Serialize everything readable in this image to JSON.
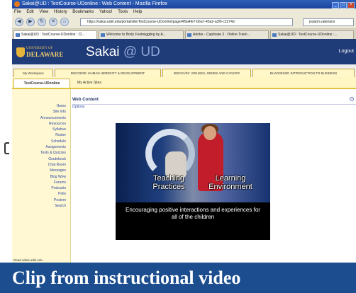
{
  "browser": {
    "window_title": "Sakai@UD : TestCourse-UDonline : Web Content - Mozilla Firefox",
    "menu": [
      "File",
      "Edit",
      "View",
      "History",
      "Bookmarks",
      "Yahoo!",
      "Tools",
      "Help"
    ],
    "url": "https://sakai.udel.edu/portal/site/TestCourse-UDonline/page/4f9a4fe7-b6a7-45a2-a3f0-c2274d",
    "search_value": "joseph.valeriano",
    "tabs": [
      {
        "label": "Sakai@UD : TestCourse-UDonline : Cl..."
      },
      {
        "label": "Welcome to Body Footwiggling by A..."
      },
      {
        "label": "Adobe - Captivate 3 : Online Traini..."
      },
      {
        "label": "Sakai@UD : TestCourse-UDonline :..."
      }
    ]
  },
  "header": {
    "logo_top": "UNIVERSITY OF",
    "logo_main": "DELAWARE",
    "brand": "Sakai",
    "brand_suffix": "@ UD",
    "logout": "Logout"
  },
  "worksites": [
    "My Workspace",
    "BISC05/06: HUMAN HEREDITY & DEVELOPMENT",
    "BISC01/02: VIRUSES, GENES AND CANCER",
    "BUAD301/08: INTRODUCTION TO BUSINESS"
  ],
  "subsites": [
    "TestCourse-UDonline",
    "My Active Sites"
  ],
  "sidebar": {
    "items": [
      "Home",
      "Site Info",
      "Announcements",
      "Resources",
      "Syllabus",
      "Roster",
      "Schedule",
      "Assignments",
      "Tests & Quizzes",
      "Gradebook",
      "Chat Room",
      "Messages",
      "Blog Wow",
      "Forums",
      "Podcasts",
      "Polls",
      "Postem",
      "Search"
    ],
    "status": "Read sakai.udel.edu"
  },
  "content": {
    "title": "Web Content",
    "options": "Options"
  },
  "video": {
    "label_left": "Teaching\nPractices",
    "label_right": "Learning\nEnvironment",
    "caption": "Encouraging positive interactions and experiences for all of the children"
  },
  "caption_banner": "Clip from instructional video"
}
